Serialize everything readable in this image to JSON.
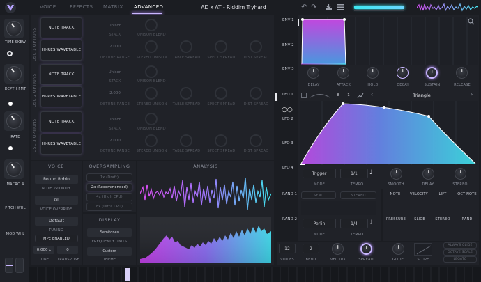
{
  "colors": {
    "bg": "#1b1d22",
    "panel": "#23262c",
    "accent": "#b48cff",
    "cyan": "#34e0e8",
    "magenta": "#d84cf0"
  },
  "header": {
    "tabs": [
      "VOICE",
      "EFFECTS",
      "MATRIX",
      "ADVANCED"
    ],
    "active_tab": "ADVANCED",
    "preset_name": "AD x AT -  Riddim Tryhard",
    "icons": [
      "logo-icon",
      "undo-icon",
      "redo-icon",
      "save-icon",
      "menu-icon"
    ]
  },
  "sidebar": {
    "items": [
      {
        "label": "TIME SKEW"
      },
      {
        "label": "DEPTH FMT"
      },
      {
        "label": "RATE"
      },
      {
        "label": "MACRO 4"
      },
      {
        "label": "PITCH WHL"
      },
      {
        "label": "MOD WHL"
      }
    ]
  },
  "osc": {
    "sections": [
      {
        "title": "OSC 1 OPTIONS",
        "buttons": [
          "NOTE TRACK",
          "HI-RES WAVETABLE"
        ]
      },
      {
        "title": "OSC 2 OPTIONS",
        "buttons": [
          "NOTE TRACK",
          "HI-RES WAVETABLE"
        ]
      },
      {
        "title": "OSC 3 OPTIONS",
        "buttons": [
          "NOTE TRACK",
          "HI-RES WAVETABLE"
        ]
      }
    ],
    "row1_values": [
      "Unison",
      "STACK",
      "UNISON BLEND"
    ],
    "row2_values": [
      "2.000",
      "DETUNE RANGE",
      "STEREO UNISON",
      "TABLE SPREAD",
      "SPECT SPREAD",
      "DIST SPREAD"
    ]
  },
  "voice": {
    "title": "VOICE",
    "note_priority_value": "Round Robin",
    "note_priority_label": "NOTE PRIORITY",
    "voice_override_value": "Kill",
    "voice_override_label": "VOICE OVERRIDE",
    "tuning_value": "Default",
    "tuning_label": "TUNING",
    "mpe_label": "MPE ENABLED",
    "tune_value": "0.000 c",
    "tune_label": "TUNE",
    "transpose_value": "0",
    "transpose_label": "TRANSPOSE"
  },
  "oversampling": {
    "title": "OVERSAMPLING",
    "options": [
      "1x (Draft)",
      "2x (Recommended)",
      "4x (High CPU)",
      "8x (Ultra CPU)"
    ],
    "selected": "2x (Recommended)"
  },
  "display": {
    "title": "DISPLAY",
    "freq_value": "Semitones",
    "freq_label": "FREQUENCY UNITS",
    "theme_value": "Custom",
    "theme_label": "THEME"
  },
  "analysis": {
    "title": "ANALYSIS"
  },
  "env": {
    "tabs": [
      "ENV 1",
      "ENV 2",
      "ENV 3"
    ],
    "knobs": [
      "DELAY",
      "ATTACK",
      "HOLD",
      "DECAY",
      "SUSTAIN",
      "RELEASE"
    ]
  },
  "lfo": {
    "tabs": [
      "LFO 1",
      "LFO 2",
      "LFO 3",
      "LFO 4"
    ],
    "rate_num": "8",
    "rate_den": "1",
    "shape": "Triangle",
    "mode_value": "Trigger",
    "mode_label": "MODE",
    "tempo_value": "1/1",
    "tempo_label": "TEMPO",
    "knobs": [
      "SMOOTH",
      "DELAY",
      "STEREO"
    ]
  },
  "rand": {
    "tabs": [
      "RAND 1",
      "RAND 2"
    ],
    "sync_label": "SYNC",
    "stereo_label": "STEREO",
    "mode_value": "Perlin",
    "mode_label": "MODE",
    "tempo_value": "1/4",
    "tempo_label": "TEMPO"
  },
  "modsources": {
    "row1": [
      "NOTE",
      "VELOCITY",
      "LIFT",
      "OCT NOTE"
    ],
    "row2": [
      "PRESSURE",
      "SLIDE",
      "STEREO",
      "RAND"
    ]
  },
  "bottom": {
    "voices_value": "12",
    "voices_label": "VOICES",
    "bend_value": "2",
    "bend_label": "BEND",
    "vel_trk_label": "VEL TRK",
    "spread_label": "SPREAD",
    "glide_label": "GLIDE",
    "slope_label": "SLOPE",
    "options": [
      "ALWAYS GLIDE",
      "OCTAVE SCALE",
      "LEGATO"
    ]
  }
}
